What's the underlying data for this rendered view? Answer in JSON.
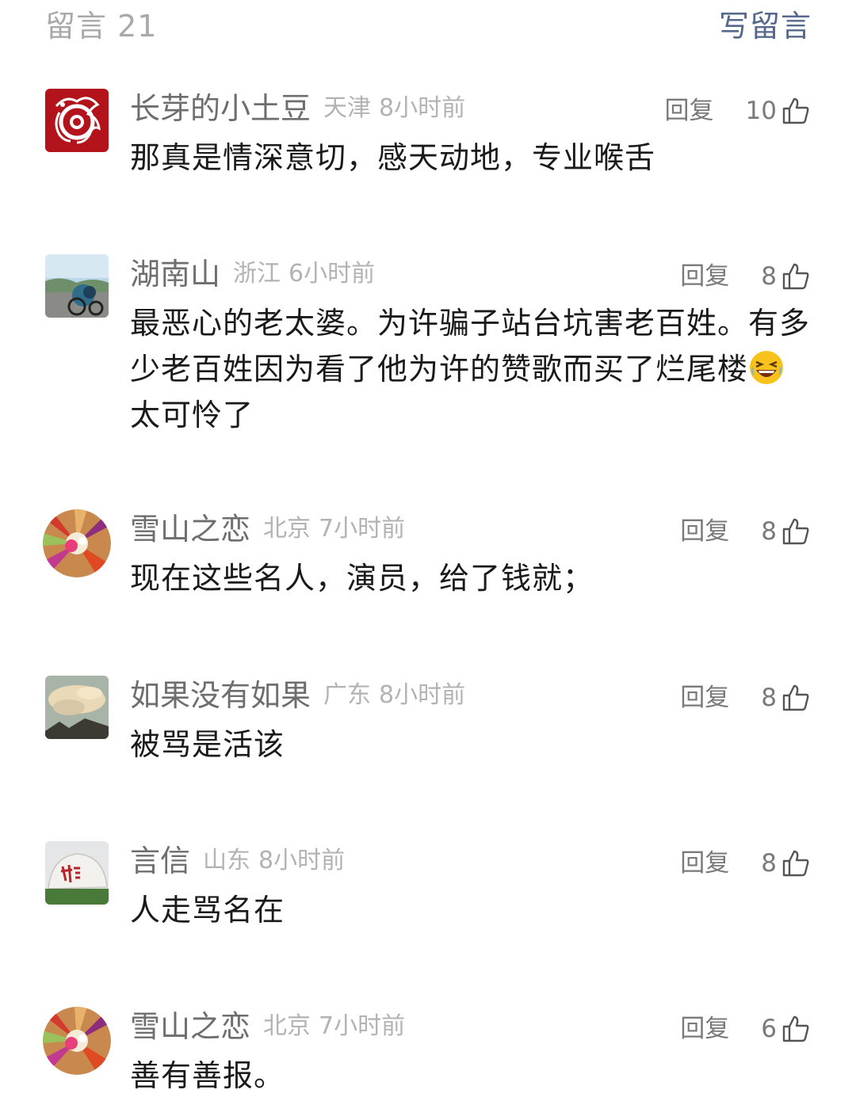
{
  "header": {
    "count_label": "留言 21",
    "write_label": "写留言"
  },
  "icons": {
    "like": "thumbs-up-icon",
    "emoji": "grinning-squinting-face-emoji"
  },
  "colors": {
    "link": "#56698c",
    "meta_gray": "#b3b3b3",
    "nickname_gray": "#6e6e6e"
  },
  "comments": [
    {
      "nickname": "长芽的小土豆",
      "location": "天津",
      "time": "8小时前",
      "reply_label": "回复",
      "likes": "10",
      "text": "那真是情深意切，感天动地，专业喉舌"
    },
    {
      "nickname": "湖南山",
      "location": "浙江",
      "time": "6小时前",
      "reply_label": "回复",
      "likes": "8",
      "text": "最恶心的老太婆。为许骗子站台坑害老百姓。有多少老百姓因为看了他为许的赞歌而买了烂尾楼",
      "text_after_emoji": "太可怜了"
    },
    {
      "nickname": "雪山之恋",
      "location": "北京",
      "time": "7小时前",
      "reply_label": "回复",
      "likes": "8",
      "text": "现在这些名人，演员，给了钱就；"
    },
    {
      "nickname": "如果没有如果",
      "location": "广东",
      "time": "8小时前",
      "reply_label": "回复",
      "likes": "8",
      "text": "被骂是活该"
    },
    {
      "nickname": "言信",
      "location": "山东",
      "time": "8小时前",
      "reply_label": "回复",
      "likes": "8",
      "text": "人走骂名在"
    },
    {
      "nickname": "雪山之恋",
      "location": "北京",
      "time": "7小时前",
      "reply_label": "回复",
      "likes": "6",
      "text": "善有善报。"
    }
  ]
}
